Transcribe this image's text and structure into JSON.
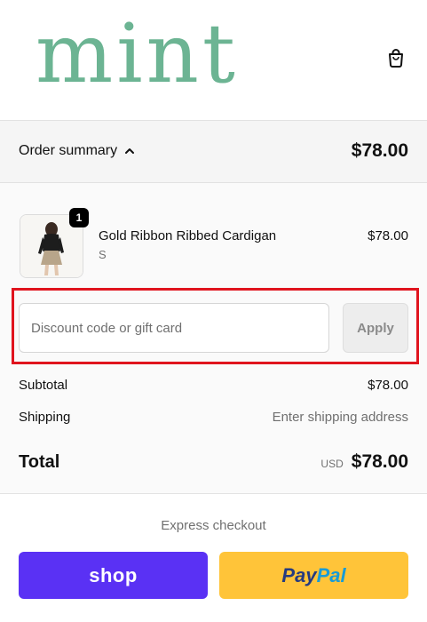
{
  "header": {
    "logo_text": "mint",
    "cart_icon": "shopping-bag-icon"
  },
  "summary_bar": {
    "toggle_label": "Order summary",
    "toggle_icon": "chevron-up-icon",
    "total": "$78.00"
  },
  "line_item": {
    "quantity": "1",
    "name": "Gold Ribbon Ribbed Cardigan",
    "variant": "S",
    "price": "$78.00"
  },
  "discount": {
    "placeholder": "Discount code or gift card",
    "apply_label": "Apply"
  },
  "totals": {
    "subtotal_label": "Subtotal",
    "subtotal_value": "$78.00",
    "shipping_label": "Shipping",
    "shipping_value": "Enter shipping address",
    "total_label": "Total",
    "currency": "USD",
    "total_value": "$78.00"
  },
  "express": {
    "title": "Express checkout",
    "shop_label": "shop",
    "paypal_part1": "Pay",
    "paypal_part2": "Pal"
  },
  "colors": {
    "logo": "#6cb493",
    "shop_pay": "#5a31f4",
    "paypal": "#ffc439",
    "highlight": "#e0141e"
  }
}
